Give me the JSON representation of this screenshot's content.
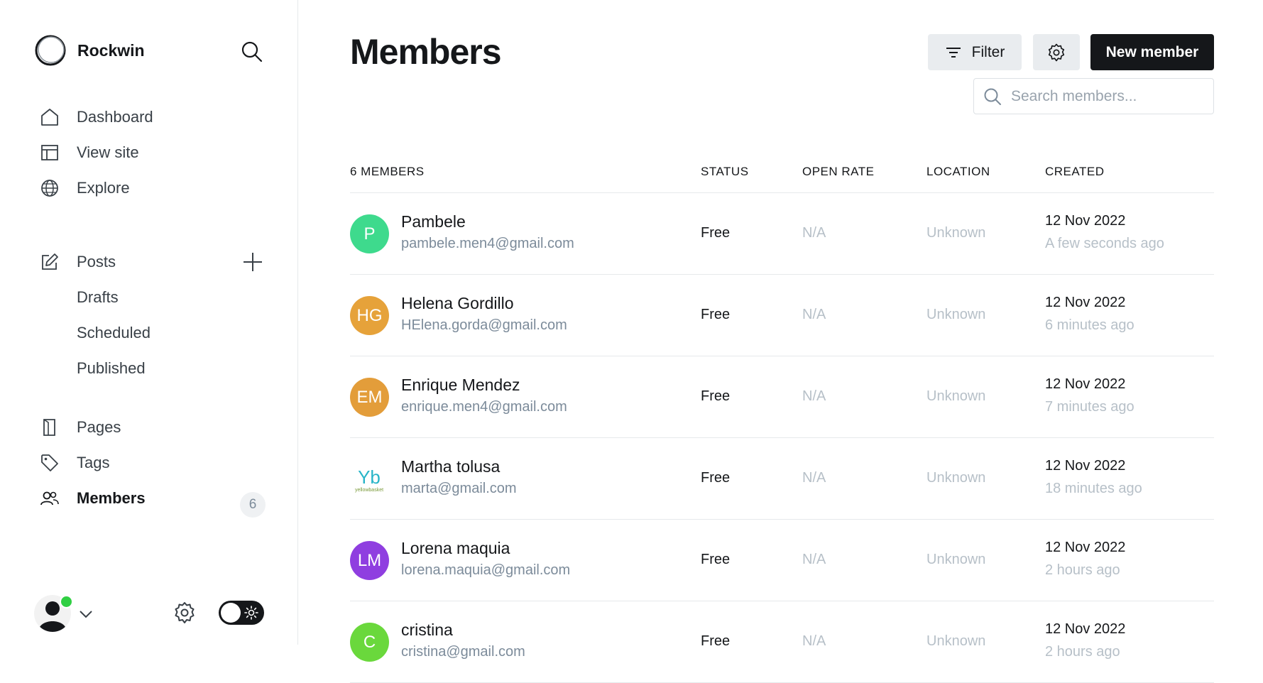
{
  "sidebar": {
    "brand": "Rockwin",
    "nav": [
      {
        "label": "Dashboard"
      },
      {
        "label": "View site"
      },
      {
        "label": "Explore"
      },
      {
        "label": "Posts"
      },
      {
        "label": "Drafts"
      },
      {
        "label": "Scheduled"
      },
      {
        "label": "Published"
      },
      {
        "label": "Pages"
      },
      {
        "label": "Tags"
      },
      {
        "label": "Members",
        "badge": "6"
      }
    ]
  },
  "header": {
    "title": "Members",
    "filter_label": "Filter",
    "new_member_label": "New member",
    "search_placeholder": "Search members..."
  },
  "table": {
    "columns": [
      "6 MEMBERS",
      "STATUS",
      "OPEN RATE",
      "LOCATION",
      "CREATED"
    ],
    "rows": [
      {
        "initials": "P",
        "color": "#3eda8d",
        "name": "Pambele",
        "email": "pambele.men4@gmail.com",
        "status": "Free",
        "open_rate": "N/A",
        "location": "Unknown",
        "created": "12 Nov 2022",
        "ago": "A few seconds ago"
      },
      {
        "initials": "HG",
        "color": "#e6a23a",
        "name": "Helena Gordillo",
        "email": "HElena.gorda@gmail.com",
        "status": "Free",
        "open_rate": "N/A",
        "location": "Unknown",
        "created": "12 Nov 2022",
        "ago": "6 minutes ago"
      },
      {
        "initials": "EM",
        "color": "#e39d3a",
        "name": "Enrique Mendez",
        "email": "enrique.men4@gmail.com",
        "status": "Free",
        "open_rate": "N/A",
        "location": "Unknown",
        "created": "12 Nov 2022",
        "ago": "7 minutes ago"
      },
      {
        "initials": "Yb",
        "logo_text": "yellowbasket",
        "color": "#29b5c8",
        "name": "Martha tolusa",
        "email": "marta@gmail.com",
        "status": "Free",
        "open_rate": "N/A",
        "location": "Unknown",
        "created": "12 Nov 2022",
        "ago": "18 minutes ago"
      },
      {
        "initials": "LM",
        "color": "#8f3ee0",
        "name": "Lorena maquia",
        "email": "lorena.maquia@gmail.com",
        "status": "Free",
        "open_rate": "N/A",
        "location": "Unknown",
        "created": "12 Nov 2022",
        "ago": "2 hours ago"
      },
      {
        "initials": "C",
        "color": "#6ad83c",
        "name": "cristina",
        "email": "cristina@gmail.com",
        "status": "Free",
        "open_rate": "N/A",
        "location": "Unknown",
        "created": "12 Nov 2022",
        "ago": "2 hours ago"
      }
    ]
  },
  "colors": {
    "accent": "#15171a",
    "online": "#30cf43"
  }
}
